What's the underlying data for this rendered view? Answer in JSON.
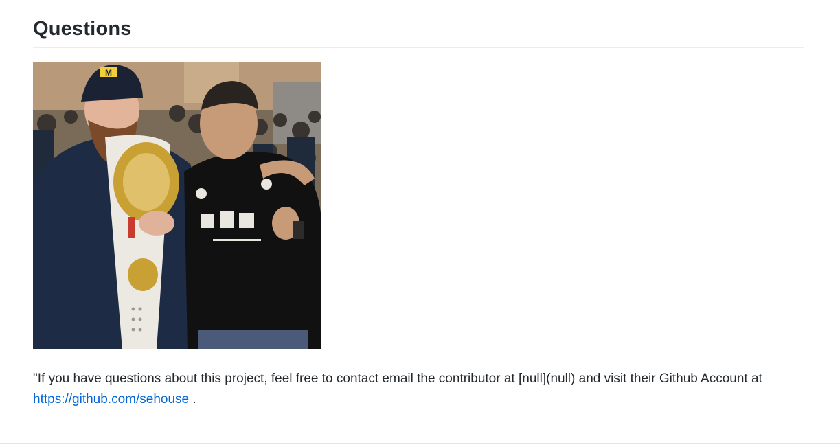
{
  "section": {
    "title": "Questions"
  },
  "photo": {
    "alt": "photo"
  },
  "message": {
    "prefix": "\"If you have questions about this project, feel free to contact email the contributor at [null](null) and visit their Github Account at ",
    "link_text": "https://github.com/sehouse",
    "link_href": "https://github.com/sehouse",
    "suffix": " ."
  },
  "colors": {
    "text": "#24292e",
    "link": "#0366d6",
    "rule": "#eaecef"
  }
}
